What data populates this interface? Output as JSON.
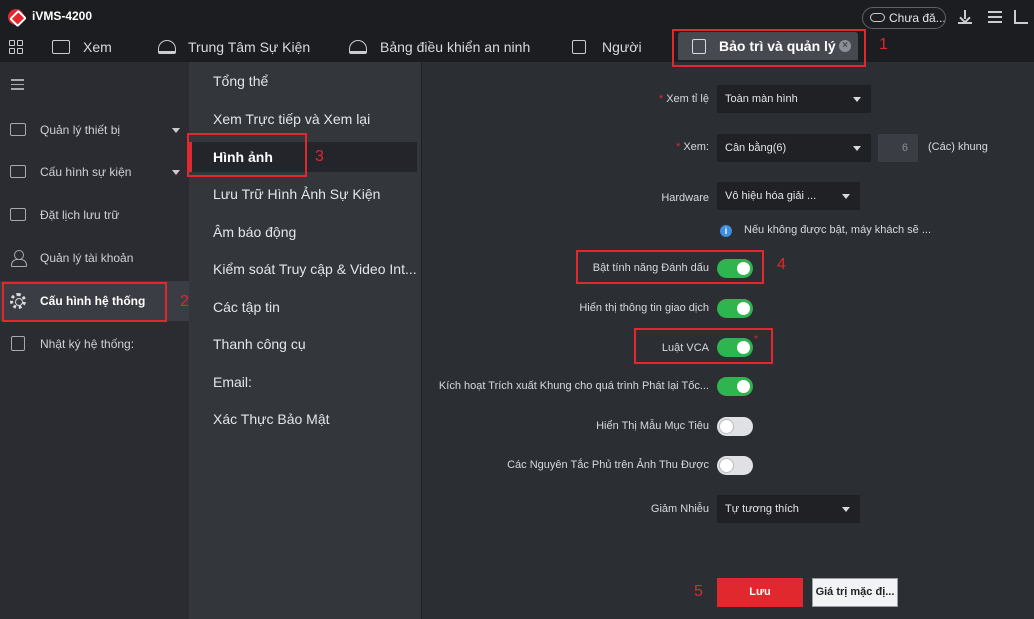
{
  "app": {
    "title": "iVMS-4200"
  },
  "titlebar": {
    "cloud_status": "Chưa đă..."
  },
  "tabs": [
    {
      "label": "Xem"
    },
    {
      "label": "Trung Tâm Sự Kiện"
    },
    {
      "label": "Bảng điều khiển an ninh"
    },
    {
      "label": "Người"
    }
  ],
  "active_tab": {
    "label": "Bảo trì và quản lý",
    "close": "×"
  },
  "sidebar": {
    "items": [
      {
        "label": "Quản lý thiết bị"
      },
      {
        "label": "Cấu hình sự kiện"
      },
      {
        "label": "Đặt lịch lưu trữ"
      },
      {
        "label": "Quản lý tài khoản"
      },
      {
        "label": "Cấu hình hệ thống"
      },
      {
        "label": "Nhật ký hệ thống:"
      }
    ]
  },
  "submenu": {
    "items": [
      {
        "label": "Tổng thể"
      },
      {
        "label": "Xem Trực tiếp và Xem lại"
      },
      {
        "label": "Hình ảnh"
      },
      {
        "label": "Lưu Trữ Hình Ảnh Sự Kiện"
      },
      {
        "label": "Âm báo động"
      },
      {
        "label": "Kiểm soát Truy cập & Video Int..."
      },
      {
        "label": "Các tập tin"
      },
      {
        "label": "Thanh công cụ"
      },
      {
        "label": "Email:"
      },
      {
        "label": "Xác Thực Bảo Mật"
      }
    ]
  },
  "form": {
    "required_mark": "*",
    "aspect": {
      "label": "Xem tỉ lệ",
      "value": "Toàn màn hình"
    },
    "view": {
      "label": "Xem:",
      "value": "Cân bằng(6)",
      "count": "6",
      "unit": "(Các) khung"
    },
    "hardware": {
      "label": "Hardware",
      "value": "Vô hiệu hóa giải ...",
      "info": "i",
      "info_text": "Nếu không được bật, máy khách sẽ ..."
    },
    "toggles": [
      {
        "label": "Bật tính năng Đánh dấu",
        "on": true
      },
      {
        "label": "Hiển thị thông tin giao dịch",
        "on": true
      },
      {
        "label": "Luật VCA",
        "on": true
      },
      {
        "label": "Kích hoạt Trích xuất Khung cho quá trình Phát lại Tốc...",
        "on": true
      },
      {
        "label": "Hiển Thị Mẫu Mục Tiêu",
        "on": false
      },
      {
        "label": "Các Nguyên Tắc Phủ trên Ảnh Thu Được",
        "on": false
      }
    ],
    "noise": {
      "label": "Giảm Nhiễu",
      "value": "Tự tương thích"
    },
    "save_label": "Lưu",
    "default_label": "Giá trị mặc đị..."
  },
  "annotations": {
    "step1": "1",
    "step2": "2",
    "step3": "3",
    "step4": "4",
    "step5": "5",
    "star": "*"
  },
  "colors": {
    "accent": "#e0282e",
    "toggle_on": "#2fb550",
    "info": "#3d8fe0"
  }
}
